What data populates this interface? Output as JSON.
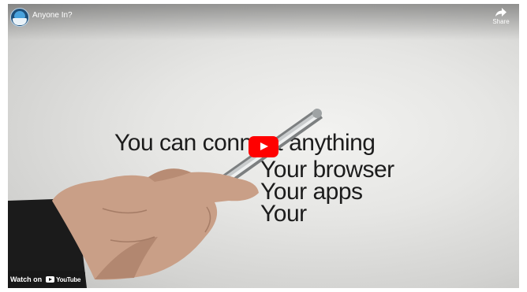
{
  "player": {
    "title": "Anyone In?",
    "share_label": "Share",
    "channel_icon": "channel-avatar-icon",
    "play_icon": "play-icon",
    "accent_color": "#ff0000"
  },
  "video_frame": {
    "lines": [
      "You can connect anything",
      "Your browser",
      "Your apps",
      "Your"
    ]
  },
  "footer": {
    "watch_label": "Watch on",
    "brand": "YouTube",
    "brand_icon": "youtube-logo-icon"
  }
}
